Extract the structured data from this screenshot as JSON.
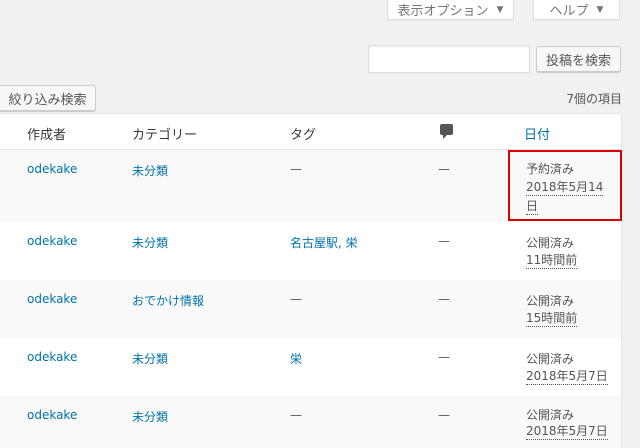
{
  "screen_options_label": "表示オプション",
  "help_label": "ヘルプ",
  "search": {
    "placeholder": "",
    "button_label": "投稿を検索"
  },
  "filter_button_label": "絞り込み検索",
  "item_count": "7個の項目",
  "columns": {
    "author": "作成者",
    "categories": "カテゴリー",
    "tags": "タグ",
    "comments_icon": "comment-bubble-icon",
    "date": "日付"
  },
  "rows": [
    {
      "author": "odekake",
      "category": "未分類",
      "tags": "—",
      "comments": "—",
      "status": "予約済み",
      "date_line1": "2018年5月14",
      "date_line2": "日"
    },
    {
      "author": "odekake",
      "category": "未分類",
      "tags": "名古屋駅, 栄",
      "comments": "—",
      "status": "公開済み",
      "date_line1": "11時間前",
      "date_line2": ""
    },
    {
      "author": "odekake",
      "category": "おでかけ情報",
      "tags": "—",
      "comments": "—",
      "status": "公開済み",
      "date_line1": "15時間前",
      "date_line2": ""
    },
    {
      "author": "odekake",
      "category": "未分類",
      "tags": "栄",
      "comments": "—",
      "status": "公開済み",
      "date_line1": "2018年5月7日",
      "date_line2": ""
    },
    {
      "author": "odekake",
      "category": "未分類",
      "tags": "—",
      "comments": "—",
      "status": "公開済み",
      "date_line1": "2018年5月7日",
      "date_line2": ""
    }
  ],
  "colors": {
    "link": "#0073aa",
    "highlight": "#dd0000"
  }
}
